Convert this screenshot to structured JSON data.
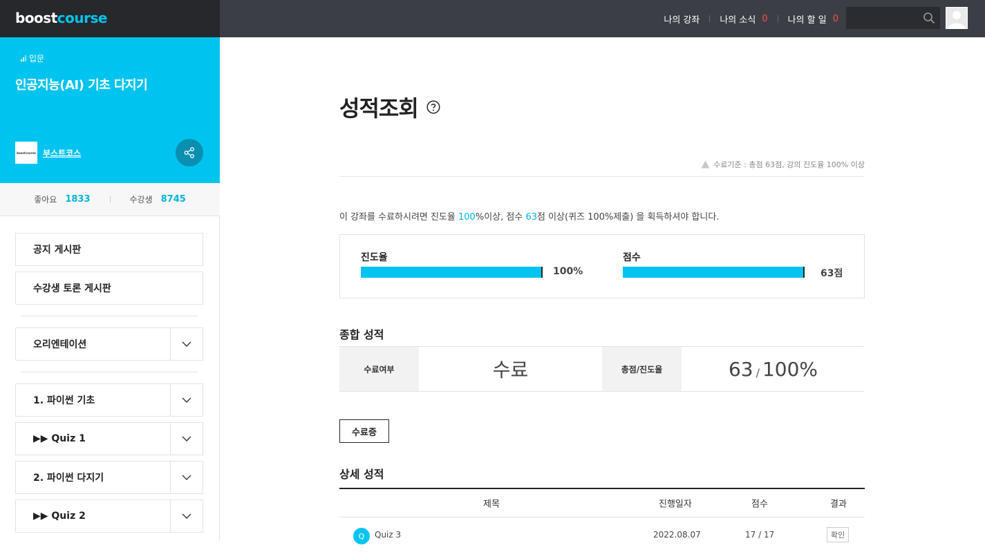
{
  "header": {
    "logo_prefix": "boost",
    "logo_suffix": "course",
    "nav": [
      {
        "label": "나의 강좌"
      },
      {
        "label": "나의 소식",
        "count": "0"
      },
      {
        "label": "나의 할 일",
        "count": "0"
      }
    ],
    "search_placeholder": ""
  },
  "sidebar": {
    "level": "입문",
    "course_title": "인공지능(AI) 기초 다지기",
    "provider_logo_text": "boostcourse",
    "provider_name": "부스트코스",
    "stats": {
      "likes_label": "좋아요",
      "likes": "1833",
      "students_label": "수강생",
      "students": "8745"
    },
    "boards": [
      "공지 게시판",
      "수강생 토론 게시판"
    ],
    "sections": [
      "오리엔테이션",
      "1. 파이썬 기초",
      "▶▶ Quiz 1",
      "2. 파이썬 다지기",
      "▶▶ Quiz 2"
    ]
  },
  "main": {
    "title": "성적조회",
    "criteria": "수료기준 : 총점 63점, 강의 진도율 100% 이상",
    "notice": {
      "t1": "이 강좌를 수료하시려면 진도율 ",
      "progress": "100",
      "t2": "%이상, 점수 ",
      "score": "63",
      "t3": "점 이상(퀴즈 100%제출) 을 획득하셔야 합니다."
    },
    "progress_label": "진도율",
    "progress_value": "100%",
    "progress_fraction": 1.0,
    "score_label": "점수",
    "score_value": "63점",
    "score_fraction": 1.0,
    "summary_title": "종합 성적",
    "completion_label": "수료여부",
    "completion_value": "수료",
    "total_label": "총점/진도율",
    "total_score": "63",
    "total_sep": "/",
    "total_progress": "100%",
    "cert_button": "수료증",
    "detail_title": "상세 성적",
    "detail_headers": {
      "title": "제목",
      "date": "진행일자",
      "score": "점수",
      "result": "결과"
    },
    "detail_rows": [
      {
        "badge": "Q",
        "title": "Quiz 3",
        "date": "2022.08.07",
        "score": "17 / 17",
        "result": "확인"
      }
    ]
  },
  "colors": {
    "accent": "#00c4f0",
    "topbar": "#3b3f45",
    "alert": "#ff4a4a"
  }
}
